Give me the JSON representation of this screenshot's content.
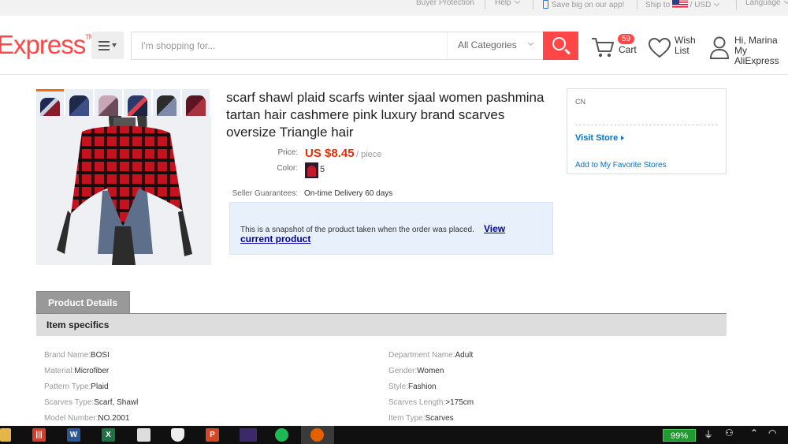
{
  "topbar": {
    "buyer_protection": "Buyer Protection",
    "help": "Help",
    "app_promo": "Save big on our app!",
    "ship_to": "Ship to",
    "currency": "/ USD",
    "language": "Language"
  },
  "header": {
    "logo": "Express",
    "logo_tm": "TM",
    "search_placeholder": "I'm shopping for...",
    "category": "All Categories",
    "cart_count": "59",
    "cart_label": "Cart",
    "wish_line1": "Wish",
    "wish_line2": "List",
    "greeting": "Hi, Marina",
    "account": "My AliExpress"
  },
  "product": {
    "title": "scarf shawl plaid scarfs winter sjaal women pashmina tartan hair cashmere pink luxury brand scarves oversize Triangle hair",
    "price_label": "Price:",
    "price": "US $8.45",
    "per": "/ piece",
    "color_label": "Color:",
    "color_count": "5",
    "guarantee_label": "Seller Guarantees:",
    "guarantee": "On-time Delivery 60 days",
    "snapshot_text": "This is a snapshot of the product taken when the order was placed.",
    "view_link_1": "View",
    "view_link_2": "current product"
  },
  "store": {
    "country": "CN",
    "visit": "Visit Store",
    "favorite": "Add to My Favorite Stores"
  },
  "details": {
    "tab": "Product Details",
    "section": "Item specifics",
    "specs": [
      {
        "k": "Brand Name:",
        "v": "BOSI"
      },
      {
        "k": "Department Name:",
        "v": "Adult"
      },
      {
        "k": "Material:",
        "v": "Microfiber"
      },
      {
        "k": "Gender:",
        "v": "Women"
      },
      {
        "k": "Pattern Type:",
        "v": "Plaid"
      },
      {
        "k": "Style:",
        "v": "Fashion"
      },
      {
        "k": "Scarves Type:",
        "v": "Scarf, Shawl"
      },
      {
        "k": "Scarves Length:",
        "v": ">175cm"
      },
      {
        "k": "Model Number:",
        "v": "NO.2001"
      },
      {
        "k": "Item Type:",
        "v": "Scarves"
      }
    ]
  },
  "taskbar": {
    "battery": "99%",
    "word": "W",
    "excel": "X",
    "powerpoint": "P",
    "app_red": "|||"
  },
  "colors": {
    "brand": "#ff4747",
    "price": "#e62e04",
    "link": "#0073c6"
  }
}
